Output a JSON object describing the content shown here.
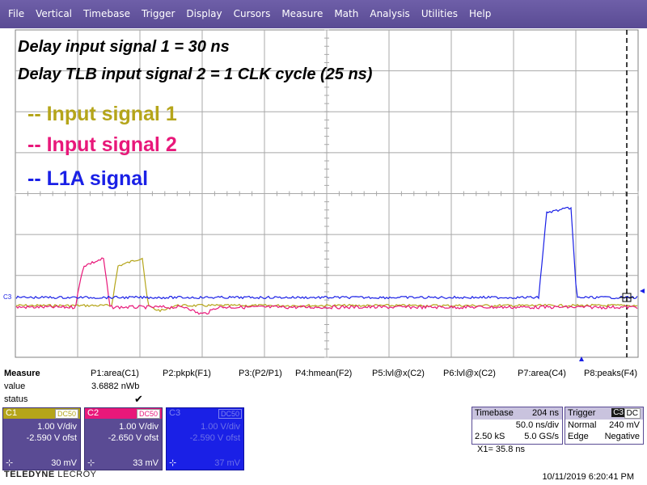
{
  "menu": {
    "items": [
      "File",
      "Vertical",
      "Timebase",
      "Trigger",
      "Display",
      "Cursors",
      "Measure",
      "Math",
      "Analysis",
      "Utilities",
      "Help"
    ]
  },
  "annotations": {
    "line1": "Delay input signal 1 = 30 ns",
    "line2": "Delay TLB input signal 2 = 1 CLK cycle (25 ns)"
  },
  "legend": {
    "signal1": "-- Input signal 1",
    "signal2": "-- Input signal 2",
    "signal3": "-- L1A signal"
  },
  "colors": {
    "c1": "#b5a51a",
    "c2": "#e8187a",
    "c3": "#1a20e6",
    "menu_bg": "#5a4b94",
    "grid": "#a0a0a0"
  },
  "trace_marker_label": "C3",
  "measure": {
    "title": "Measure",
    "row_value": "value",
    "row_status": "status",
    "params": [
      "P1:area(C1)",
      "P2:pkpk(F1)",
      "P3:(P2/P1)",
      "P4:hmean(F2)",
      "P5:lvl@x(C2)",
      "P6:lvl@x(C2)",
      "P7:area(C4)",
      "P8:peaks(F4)"
    ],
    "p1_value": "3.6882 nWb",
    "p1_status": "✔"
  },
  "channels": [
    {
      "name": "C1",
      "coupling": "DC50",
      "vdiv": "1.00 V/div",
      "offset": "-2.590 V ofst",
      "value": "30 mV",
      "color": "#b5a51a"
    },
    {
      "name": "C2",
      "coupling": "DC50",
      "vdiv": "1.00 V/div",
      "offset": "-2.650 V ofst",
      "value": "33 mV",
      "color": "#e8187a"
    },
    {
      "name": "C3",
      "coupling": "DC50",
      "vdiv": "1.00 V/div",
      "offset": "-2.590 V ofst",
      "value": "37 mV",
      "color": "#1a20e6"
    }
  ],
  "timebase": {
    "label": "Timebase",
    "delay": "204 ns",
    "tdiv": "50.0 ns/div",
    "samples": "2.50 kS",
    "rate": "5.0 GS/s"
  },
  "trigger": {
    "label": "Trigger",
    "channel": "C3",
    "coupling": "DC",
    "mode": "Normal",
    "level": "240 mV",
    "type": "Edge",
    "slope": "Negative"
  },
  "cursor": {
    "x1": "X1=  35.8 ns"
  },
  "logo": {
    "brand": "TELEDYNE",
    "sub": "LECROY"
  },
  "datetime": "10/11/2019 6:20:41 PM"
}
